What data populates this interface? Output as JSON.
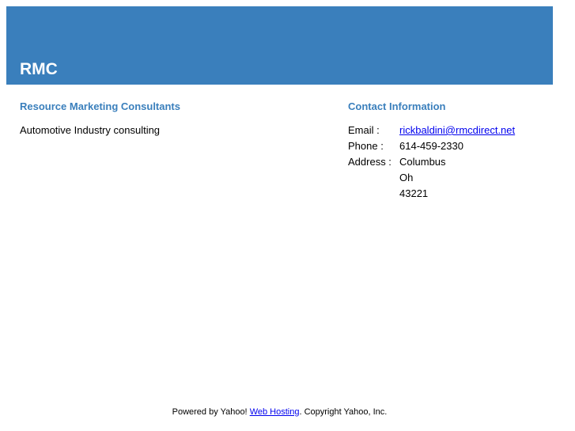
{
  "header": {
    "title": "RMC",
    "background_color": "#3a7fbc"
  },
  "company": {
    "name": "Resource Marketing Consultants",
    "description": "Automotive Industry consulting"
  },
  "contact": {
    "heading": "Contact Information",
    "email_label": "Email :",
    "email": "rickbaldini@rmcdirect.net",
    "phone_label": "Phone :",
    "phone": "614-459-2330",
    "address_label": "Address :",
    "address_city": "Columbus",
    "address_state": "Oh",
    "address_zip": "43221"
  },
  "footer": {
    "prefix": "Powered by Yahoo! ",
    "link_text": "Web Hosting",
    "suffix": ". Copyright Yahoo, Inc."
  },
  "colors": {
    "accent": "#3a7fbc",
    "link": "#0000ee"
  }
}
